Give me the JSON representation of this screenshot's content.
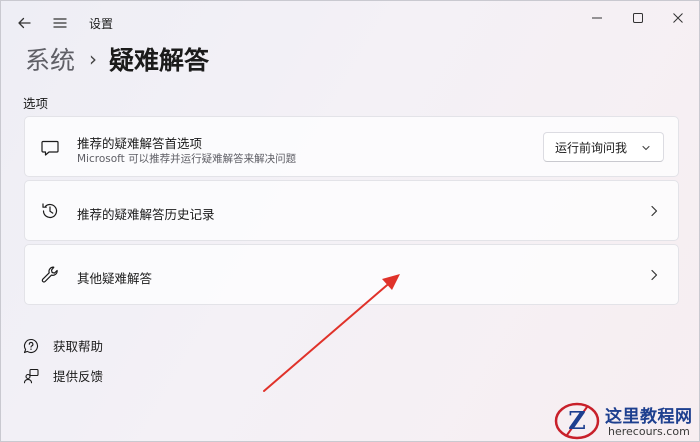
{
  "window": {
    "app_title": "设置"
  },
  "breadcrumb": {
    "parent": "系统",
    "separator": "›",
    "current": "疑难解答"
  },
  "section": {
    "label": "选项"
  },
  "cards": [
    {
      "title": "推荐的疑难解答首选项",
      "subtitle": "Microsoft 可以推荐并运行疑难解答来解决问题",
      "icon": "chat-bubble-icon",
      "dropdown_value": "运行前询问我"
    },
    {
      "title": "推荐的疑难解答历史记录",
      "icon": "history-icon"
    },
    {
      "title": "其他疑难解答",
      "icon": "wrench-icon"
    }
  ],
  "links": [
    {
      "label": "获取帮助",
      "icon": "help-icon"
    },
    {
      "label": "提供反馈",
      "icon": "feedback-icon"
    }
  ],
  "annotation": {
    "arrow_color": "#e0322a"
  },
  "watermark": {
    "title": "这里教程网",
    "url": "herecours.com",
    "logo_letter": "Z"
  }
}
